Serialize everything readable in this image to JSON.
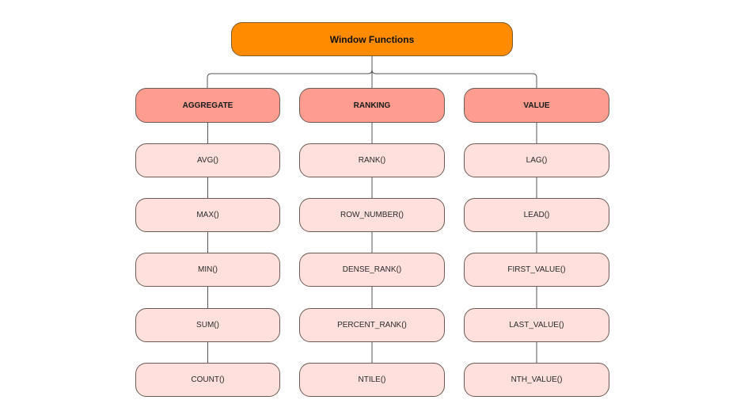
{
  "diagram": {
    "root": {
      "label": "Window Functions"
    },
    "categories": [
      {
        "label": "AGGREGATE",
        "items": [
          "AVG()",
          "MAX()",
          "MIN()",
          "SUM()",
          "COUNT()"
        ]
      },
      {
        "label": "RANKING",
        "items": [
          "RANK()",
          "ROW_NUMBER()",
          "DENSE_RANK()",
          "PERCENT_RANK()",
          "NTILE()"
        ]
      },
      {
        "label": "VALUE",
        "items": [
          "LAG()",
          "LEAD()",
          "FIRST_VALUE()",
          "LAST_VALUE()",
          "NTH_VALUE()"
        ]
      }
    ],
    "colors": {
      "root_fill": "#ff8c00",
      "category_fill": "#fd9c8f",
      "leaf_fill": "#ffe0dc",
      "connector": "#555555"
    }
  }
}
